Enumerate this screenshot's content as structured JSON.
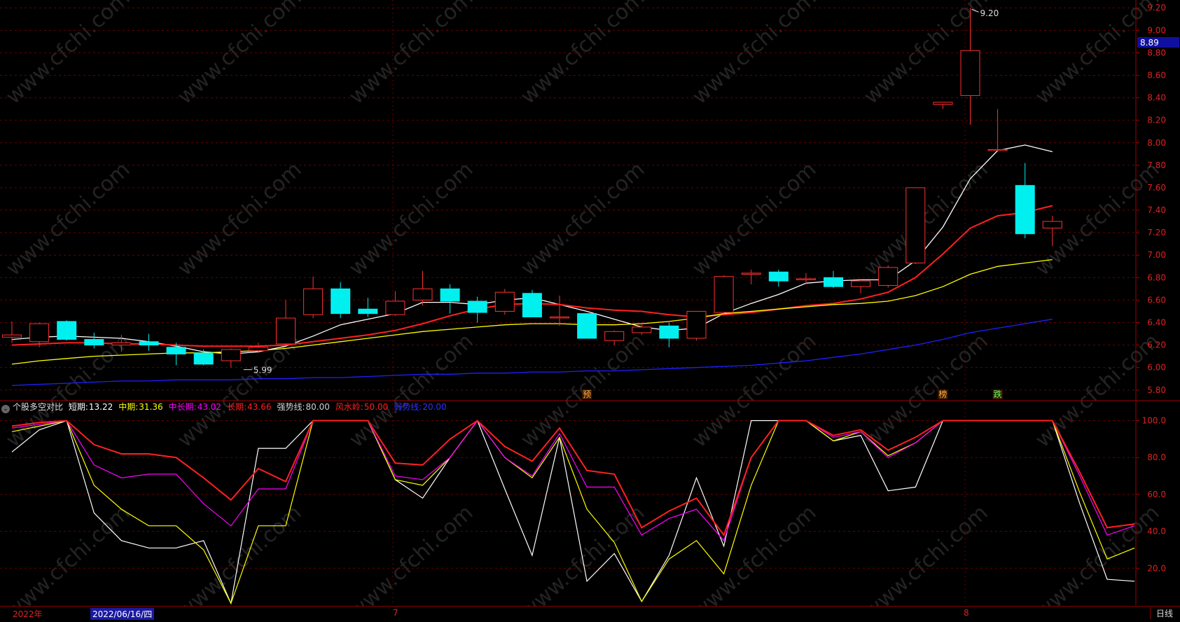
{
  "indicator": {
    "name": "个股多空对比",
    "items": [
      {
        "label": "短期:",
        "value": "13.22",
        "color": "#ffffff"
      },
      {
        "label": "中期:",
        "value": "31.36",
        "color": "#ffff00"
      },
      {
        "label": "中长期:",
        "value": "43.02",
        "color": "#ff00ff"
      },
      {
        "label": "长期:",
        "value": "43.66",
        "color": "#ff2020"
      },
      {
        "label": "强势线:",
        "value": "80.00",
        "color": "#d0d0d0"
      },
      {
        "label": "风水岭:",
        "value": "50.00",
        "color": "#ff2020"
      },
      {
        "label": "弱势线:",
        "value": "20.00",
        "color": "#3030ff"
      }
    ]
  },
  "watermark": "www.cfchi.com",
  "bottom_bar": {
    "year_label": "2022年",
    "cursor_date": "2022/06/16/四",
    "month_labels": [
      "7",
      "8"
    ],
    "period": "日线"
  },
  "chart_data": [
    {
      "type": "candlestick",
      "ylim": [
        5.73,
        9.27
      ],
      "y_ticks": [
        5.8,
        6.0,
        6.2,
        6.4,
        6.6,
        6.8,
        7.0,
        7.2,
        7.4,
        7.6,
        7.8,
        8.0,
        8.2,
        8.4,
        8.6,
        8.8,
        9.0,
        9.2
      ],
      "current_price": "8.89",
      "high_label": "9.20",
      "low_label": "5.99",
      "candles": [
        {
          "o": 6.27,
          "h": 6.41,
          "l": 6.22,
          "c": 6.29
        },
        {
          "o": 6.23,
          "h": 6.4,
          "l": 6.18,
          "c": 6.39
        },
        {
          "o": 6.41,
          "h": 6.42,
          "l": 6.24,
          "c": 6.25
        },
        {
          "o": 6.25,
          "h": 6.31,
          "l": 6.17,
          "c": 6.2
        },
        {
          "o": 6.2,
          "h": 6.29,
          "l": 6.14,
          "c": 6.22
        },
        {
          "o": 6.23,
          "h": 6.3,
          "l": 6.15,
          "c": 6.2
        },
        {
          "o": 6.18,
          "h": 6.22,
          "l": 6.02,
          "c": 6.12
        },
        {
          "o": 6.13,
          "h": 6.16,
          "l": 6.02,
          "c": 6.03
        },
        {
          "o": 6.06,
          "h": 6.17,
          "l": 6.0,
          "c": 6.16
        },
        {
          "o": 6.15,
          "h": 6.22,
          "l": 6.13,
          "c": 6.18
        },
        {
          "o": 6.21,
          "h": 6.6,
          "l": 6.2,
          "c": 6.44
        },
        {
          "o": 6.47,
          "h": 6.81,
          "l": 6.44,
          "c": 6.7
        },
        {
          "o": 6.7,
          "h": 6.76,
          "l": 6.44,
          "c": 6.48
        },
        {
          "o": 6.52,
          "h": 6.62,
          "l": 6.45,
          "c": 6.48
        },
        {
          "o": 6.47,
          "h": 6.68,
          "l": 6.46,
          "c": 6.59
        },
        {
          "o": 6.6,
          "h": 6.86,
          "l": 6.55,
          "c": 6.7
        },
        {
          "o": 6.7,
          "h": 6.74,
          "l": 6.48,
          "c": 6.59
        },
        {
          "o": 6.59,
          "h": 6.63,
          "l": 6.4,
          "c": 6.49
        },
        {
          "o": 6.5,
          "h": 6.7,
          "l": 6.47,
          "c": 6.67
        },
        {
          "o": 6.66,
          "h": 6.69,
          "l": 6.45,
          "c": 6.45
        },
        {
          "o": 6.45,
          "h": 6.64,
          "l": 6.37,
          "c": 6.45
        },
        {
          "o": 6.48,
          "h": 6.48,
          "l": 6.26,
          "c": 6.26
        },
        {
          "o": 6.24,
          "h": 6.33,
          "l": 6.2,
          "c": 6.32
        },
        {
          "o": 6.31,
          "h": 6.4,
          "l": 6.29,
          "c": 6.36
        },
        {
          "o": 6.37,
          "h": 6.4,
          "l": 6.18,
          "c": 6.26
        },
        {
          "o": 6.26,
          "h": 6.5,
          "l": 6.24,
          "c": 6.5
        },
        {
          "o": 6.49,
          "h": 6.82,
          "l": 6.48,
          "c": 6.81
        },
        {
          "o": 6.83,
          "h": 6.87,
          "l": 6.74,
          "c": 6.84
        },
        {
          "o": 6.85,
          "h": 6.87,
          "l": 6.72,
          "c": 6.77
        },
        {
          "o": 6.79,
          "h": 6.84,
          "l": 6.74,
          "c": 6.79
        },
        {
          "o": 6.8,
          "h": 6.86,
          "l": 6.71,
          "c": 6.72
        },
        {
          "o": 6.72,
          "h": 6.79,
          "l": 6.66,
          "c": 6.77
        },
        {
          "o": 6.73,
          "h": 6.91,
          "l": 6.71,
          "c": 6.89
        },
        {
          "o": 6.93,
          "h": 7.6,
          "l": 6.92,
          "c": 7.6
        },
        {
          "o": 8.34,
          "h": 8.36,
          "l": 8.3,
          "c": 8.36
        },
        {
          "o": 8.42,
          "h": 9.2,
          "l": 8.16,
          "c": 8.82
        },
        {
          "o": 7.94,
          "h": 8.3,
          "l": 7.94,
          "c": 7.94
        },
        {
          "o": 7.62,
          "h": 7.82,
          "l": 7.15,
          "c": 7.19
        },
        {
          "o": 7.24,
          "h": 7.35,
          "l": 7.08,
          "c": 7.3
        }
      ],
      "series": [
        {
          "type": "line",
          "color": "#ffffff",
          "values": [
            6.25,
            6.27,
            6.28,
            6.27,
            6.26,
            6.23,
            6.19,
            6.14,
            6.12,
            6.14,
            6.19,
            6.28,
            6.38,
            6.43,
            6.48,
            6.58,
            6.58,
            6.56,
            6.6,
            6.62,
            6.56,
            6.5,
            6.43,
            6.36,
            6.33,
            6.35,
            6.48,
            6.57,
            6.65,
            6.75,
            6.77,
            6.78,
            6.78,
            6.95,
            7.25,
            7.68,
            7.93,
            7.98,
            7.92
          ]
        },
        {
          "type": "line",
          "color": "#ff2020",
          "values": [
            6.2,
            6.21,
            6.22,
            6.22,
            6.21,
            6.21,
            6.2,
            6.19,
            6.19,
            6.19,
            6.2,
            6.23,
            6.26,
            6.29,
            6.33,
            6.39,
            6.46,
            6.52,
            6.56,
            6.57,
            6.56,
            6.53,
            6.51,
            6.5,
            6.47,
            6.45,
            6.47,
            6.49,
            6.52,
            6.55,
            6.57,
            6.61,
            6.67,
            6.8,
            7.01,
            7.24,
            7.35,
            7.38,
            7.44
          ]
        },
        {
          "type": "line",
          "color": "#ffff00",
          "values": [
            6.03,
            6.06,
            6.08,
            6.1,
            6.11,
            6.12,
            6.13,
            6.13,
            6.14,
            6.15,
            6.17,
            6.2,
            6.23,
            6.26,
            6.29,
            6.32,
            6.34,
            6.36,
            6.38,
            6.39,
            6.39,
            6.38,
            6.38,
            6.39,
            6.41,
            6.44,
            6.48,
            6.5,
            6.52,
            6.54,
            6.56,
            6.57,
            6.59,
            6.64,
            6.72,
            6.83,
            6.9,
            6.93,
            6.96
          ]
        },
        {
          "type": "line",
          "color": "#2020ff",
          "values": [
            5.84,
            5.85,
            5.86,
            5.87,
            5.88,
            5.88,
            5.89,
            5.89,
            5.89,
            5.9,
            5.9,
            5.91,
            5.91,
            5.92,
            5.93,
            5.94,
            5.94,
            5.95,
            5.95,
            5.96,
            5.96,
            5.97,
            5.97,
            5.98,
            5.99,
            6.0,
            6.01,
            6.02,
            6.04,
            6.06,
            6.09,
            6.12,
            6.16,
            6.2,
            6.25,
            6.31,
            6.35,
            6.39,
            6.43
          ]
        }
      ],
      "markers": [
        {
          "index": 21,
          "label": "预"
        },
        {
          "index": 34,
          "label": "榜"
        },
        {
          "index": 36,
          "label": "跌"
        }
      ]
    },
    {
      "type": "line",
      "ylim": [
        0,
        104
      ],
      "y_ticks": [
        20.0,
        40.0,
        60.0,
        80.0,
        100.0
      ],
      "series": [
        {
          "name": "短期",
          "color": "#ffffff",
          "values": [
            83,
            95,
            100,
            50,
            35,
            31,
            31,
            35,
            1,
            85,
            85,
            100,
            100,
            100,
            68,
            58,
            80,
            100,
            63,
            27,
            91,
            13,
            28,
            2,
            27,
            69,
            32,
            100,
            100,
            100,
            89,
            92,
            62,
            64,
            100,
            100,
            100,
            100,
            100,
            55,
            14,
            13
          ]
        },
        {
          "name": "中期",
          "color": "#ffff00",
          "values": [
            94,
            97,
            100,
            65,
            52,
            43,
            43,
            30,
            1,
            43,
            43,
            100,
            100,
            100,
            68,
            65,
            80,
            100,
            80,
            69,
            91,
            52,
            34,
            2,
            25,
            35,
            17,
            65,
            100,
            100,
            89,
            94,
            81,
            88,
            100,
            100,
            100,
            100,
            100,
            61,
            25,
            31
          ]
        },
        {
          "name": "中长期",
          "color": "#ff00ff",
          "values": [
            96,
            98,
            100,
            76,
            69,
            71,
            71,
            55,
            43,
            63,
            63,
            100,
            100,
            100,
            70,
            68,
            80,
            100,
            80,
            70,
            93,
            64,
            64,
            38,
            47,
            52,
            35,
            80,
            100,
            100,
            91,
            94,
            80,
            88,
            100,
            100,
            100,
            100,
            100,
            70,
            38,
            43
          ]
        },
        {
          "name": "长期",
          "color": "#ff2020",
          "values": [
            97,
            99,
            100,
            87,
            82,
            82,
            80,
            69,
            57,
            74,
            67,
            100,
            100,
            100,
            77,
            76,
            90,
            100,
            86,
            78,
            96,
            73,
            71,
            42,
            51,
            58,
            38,
            80,
            100,
            100,
            92,
            95,
            84,
            91,
            100,
            100,
            100,
            100,
            100,
            72,
            42,
            44
          ]
        }
      ]
    }
  ]
}
